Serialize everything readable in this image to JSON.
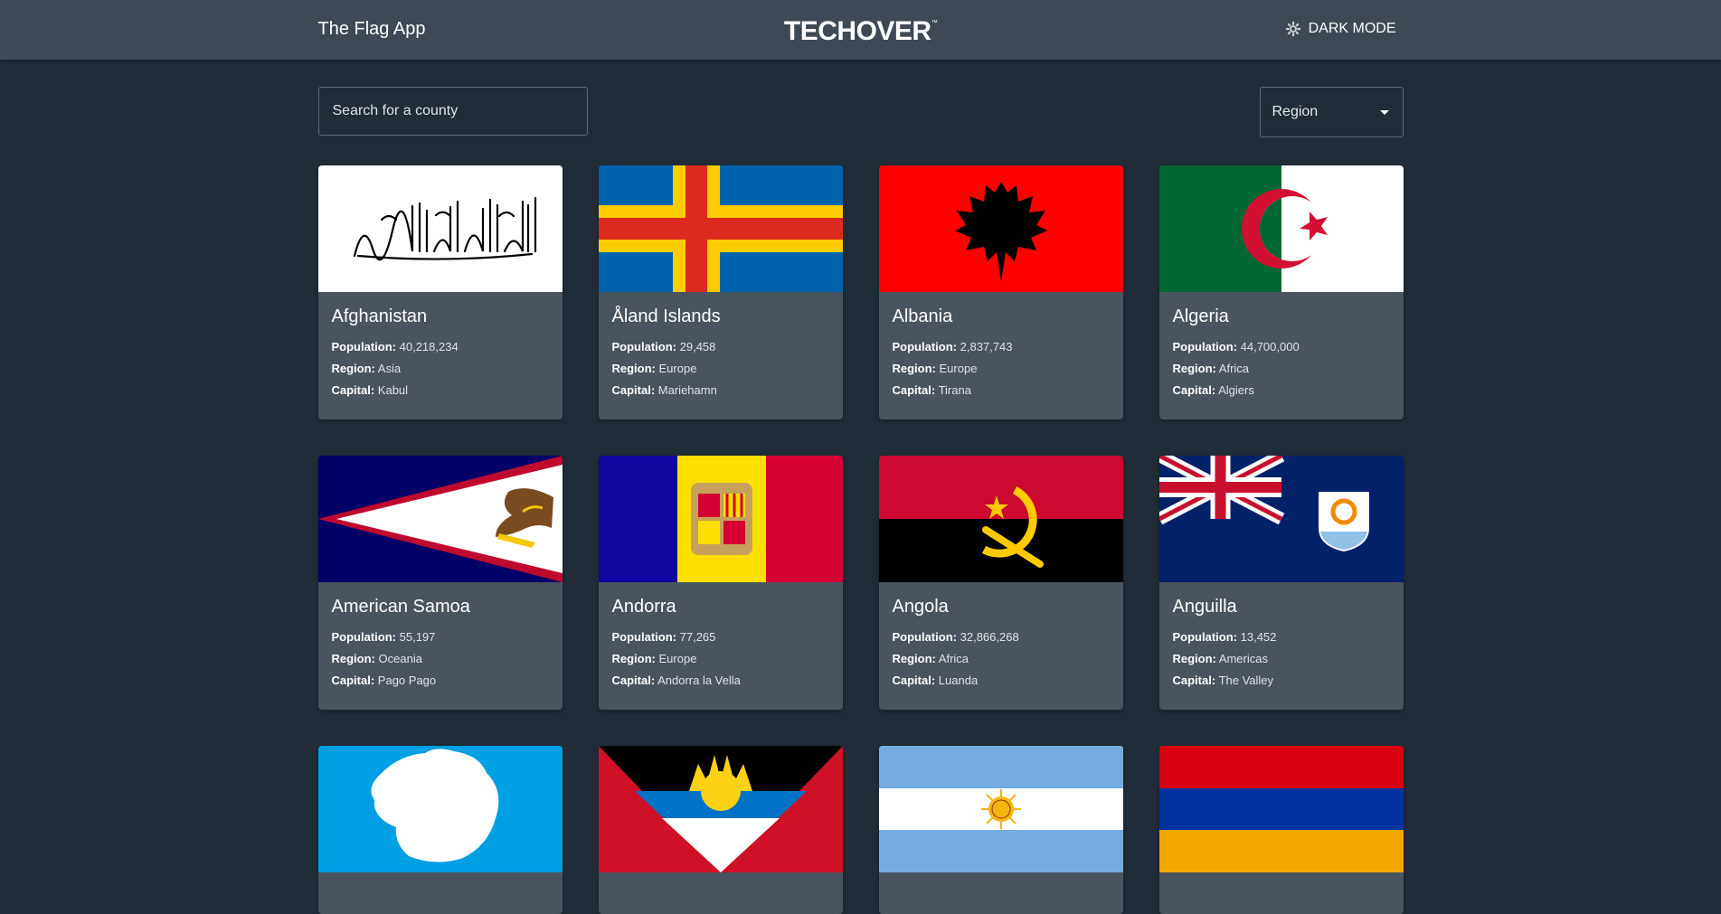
{
  "header": {
    "title": "The Flag App",
    "logo": "TECHOVER",
    "logo_mark": "™",
    "mode_label": "DARK MODE"
  },
  "search": {
    "placeholder": "Search for a county",
    "value": ""
  },
  "region_select": {
    "label": "Region"
  },
  "labels": {
    "population": "Population:",
    "region": "Region:",
    "capital": "Capital:"
  },
  "countries": [
    {
      "name": "Afghanistan",
      "population": "40,218,234",
      "region": "Asia",
      "capital": "Kabul"
    },
    {
      "name": "Åland Islands",
      "population": "29,458",
      "region": "Europe",
      "capital": "Mariehamn"
    },
    {
      "name": "Albania",
      "population": "2,837,743",
      "region": "Europe",
      "capital": "Tirana"
    },
    {
      "name": "Algeria",
      "population": "44,700,000",
      "region": "Africa",
      "capital": "Algiers"
    },
    {
      "name": "American Samoa",
      "population": "55,197",
      "region": "Oceania",
      "capital": "Pago Pago"
    },
    {
      "name": "Andorra",
      "population": "77,265",
      "region": "Europe",
      "capital": "Andorra la Vella"
    },
    {
      "name": "Angola",
      "population": "32,866,268",
      "region": "Africa",
      "capital": "Luanda"
    },
    {
      "name": "Anguilla",
      "population": "13,452",
      "region": "Americas",
      "capital": "The Valley"
    },
    {
      "name": "",
      "population": "",
      "region": "",
      "capital": ""
    },
    {
      "name": "",
      "population": "",
      "region": "",
      "capital": ""
    },
    {
      "name": "",
      "population": "",
      "region": "",
      "capital": ""
    },
    {
      "name": "",
      "population": "",
      "region": "",
      "capital": ""
    }
  ],
  "colors": {
    "background": "#202c37",
    "header": "#3e4955",
    "card": "#4a545f"
  }
}
